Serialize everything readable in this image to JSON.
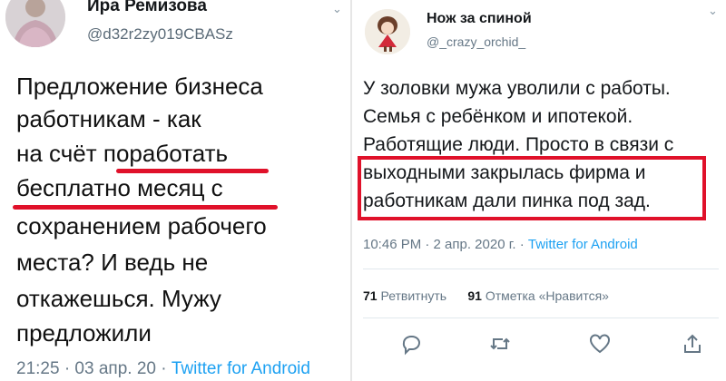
{
  "left_tweet": {
    "author_name": "Ира Ремизова",
    "handle": "@d32r2zy019CBASz",
    "text_lines": [
      "Предложение бизнеса",
      "работникам - как",
      "на счёт ",
      "поработать",
      "бесплатно месяц с",
      "сохранением рабочего",
      "места? И ведь не",
      "откажешься. Мужу",
      "предложили"
    ],
    "time": "21:25 · 03 апр. 20 · ",
    "source": "Twitter for Android",
    "highlight_color": "#e0112a"
  },
  "right_tweet": {
    "author_name": "Нож за спиной",
    "handle": "@_crazy_orchid_",
    "text_lines": [
      "У золовки мужа уволили с работы.",
      "Семья с ребёнком и ипотекой.",
      "Работящие люди. Просто в связи с",
      "выходными закрылась фирма и",
      "работникам дали пинка под зад."
    ],
    "time": "10:46 PM · 2 апр. 2020 г. · ",
    "source": "Twitter for Android",
    "retweets_count": "71",
    "retweets_label": " Ретвитнуть",
    "likes_count": "91",
    "likes_label": " Отметка «Нравится»",
    "icons": [
      "reply-icon",
      "retweet-icon",
      "like-icon",
      "share-icon"
    ],
    "highlight_color": "#e0112a",
    "link_color": "#1da1f2"
  }
}
